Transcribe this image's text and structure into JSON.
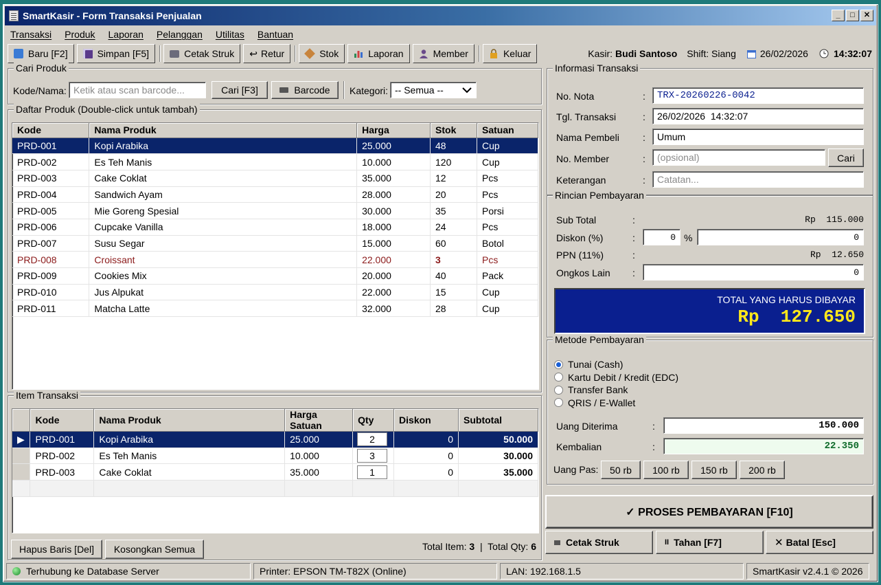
{
  "window": {
    "title": "SmartKasir - Form Transaksi Penjualan"
  },
  "menu": [
    "Transaksi",
    "Produk",
    "Laporan",
    "Pelanggan",
    "Utilitas",
    "Bantuan"
  ],
  "toolbar": {
    "new": "Baru [F2]",
    "save": "Simpan [F5]",
    "print": "Cetak Struk",
    "return": "Retur",
    "stock": "Stok",
    "report": "Laporan",
    "member": "Member",
    "exit": "Keluar",
    "cashier_label": "Kasir:",
    "cashier": "Budi Santoso",
    "shift": "Shift: Siang",
    "date": "26/02/2026",
    "time": "14:32:07"
  },
  "search": {
    "legend": "Cari Produk",
    "label": "Kode/Nama:",
    "placeholder": "Ketik atau scan barcode...",
    "find_btn": "Cari [F3]",
    "barcode_btn": "Barcode",
    "category_label": "Kategori:",
    "category_value": "-- Semua --"
  },
  "products": {
    "legend": "Daftar Produk (Double-click untuk tambah)",
    "columns": [
      "Kode",
      "Nama Produk",
      "Harga",
      "Stok",
      "Satuan"
    ],
    "rows": [
      [
        "PRD-001",
        "Kopi Arabika",
        "25.000",
        "48",
        "Cup"
      ],
      [
        "PRD-002",
        "Es Teh Manis",
        "10.000",
        "120",
        "Cup"
      ],
      [
        "PRD-003",
        "Cake Coklat",
        "35.000",
        "12",
        "Pcs"
      ],
      [
        "PRD-004",
        "Sandwich Ayam",
        "28.000",
        "20",
        "Pcs"
      ],
      [
        "PRD-005",
        "Mie Goreng Spesial",
        "30.000",
        "35",
        "Porsi"
      ],
      [
        "PRD-006",
        "Cupcake Vanilla",
        "18.000",
        "24",
        "Pcs"
      ],
      [
        "PRD-007",
        "Susu Segar",
        "15.000",
        "60",
        "Botol"
      ],
      [
        "PRD-008",
        "Croissant",
        "22.000",
        "3",
        "Pcs"
      ],
      [
        "PRD-009",
        "Cookies Mix",
        "20.000",
        "40",
        "Pack"
      ],
      [
        "PRD-010",
        "Jus Alpukat",
        "22.000",
        "15",
        "Cup"
      ],
      [
        "PRD-011",
        "Matcha Latte",
        "32.000",
        "28",
        "Cup"
      ]
    ]
  },
  "items": {
    "legend": "Item Transaksi",
    "columns": [
      "Kode",
      "Nama Produk",
      "Harga Satuan",
      "Qty",
      "Diskon",
      "Subtotal"
    ],
    "rows": [
      [
        "PRD-001",
        "Kopi Arabika",
        "25.000",
        "2",
        "0",
        "50.000"
      ],
      [
        "PRD-002",
        "Es Teh Manis",
        "10.000",
        "3",
        "0",
        "30.000"
      ],
      [
        "PRD-003",
        "Cake Coklat",
        "35.000",
        "1",
        "0",
        "35.000"
      ]
    ],
    "delete_btn": "Hapus Baris [Del]",
    "clear_btn": "Kosongkan Semua",
    "total_item_label": "Total Item:",
    "total_item": "3",
    "total_qty_label": "Total Qty:",
    "total_qty": "6"
  },
  "info": {
    "legend": "Informasi Transaksi",
    "nota_label": "No. Nota",
    "nota": "TRX-20260226-0042",
    "tgl_label": "Tgl. Transaksi",
    "tgl": "26/02/2026  14:32:07",
    "buyer_label": "Nama Pembeli",
    "buyer": "Umum",
    "member_label": "No. Member",
    "member_placeholder": "(opsional)",
    "member_btn": "Cari",
    "note_label": "Keterangan",
    "note_placeholder": "Catatan..."
  },
  "payment": {
    "legend": "Rincian Pembayaran",
    "subtotal_label": "Sub Total",
    "subtotal": "Rp  115.000",
    "discount_label": "Diskon (%)",
    "discount_pct": "0",
    "discount_amount": "0",
    "ppn_label": "PPN (11%)",
    "ppn": "Rp  12.650",
    "other_label": "Ongkos Lain",
    "other": "0",
    "total_label": "TOTAL YANG HARUS DIBAYAR",
    "total": "Rp  127.650"
  },
  "method": {
    "legend": "Metode Pembayaran",
    "options": [
      "Tunai (Cash)",
      "Kartu Debit / Kredit (EDC)",
      "Transfer Bank",
      "QRIS / E-Wallet"
    ],
    "received_label": "Uang Diterima",
    "received": "150.000",
    "change_label": "Kembalian",
    "change": "22.350",
    "quick_label": "Uang Pas:",
    "quick": [
      "50 rb",
      "100 rb",
      "150 rb",
      "200 rb"
    ]
  },
  "actions": {
    "process": "✓ PROSES PEMBAYARAN [F10]",
    "print": "Cetak Struk",
    "hold": "Tahan [F7]",
    "cancel": "Batal [Esc]"
  },
  "status": {
    "db": "Terhubung ke Database Server",
    "printer": "Printer: EPSON TM-T82X (Online)",
    "lan": "LAN: 192.168.1.5",
    "version": "SmartKasir v2.4.1 © 2026"
  },
  "colors": {
    "selection": "#0a246a",
    "total_bg": "#0a1f8f",
    "total_text": "#ffe81a",
    "change_bg": "#eefbee",
    "change_text": "#0e6b2a",
    "low_stock": "#8b1a1a"
  }
}
